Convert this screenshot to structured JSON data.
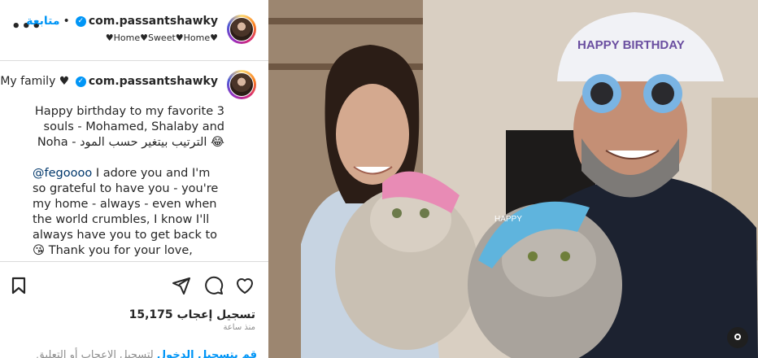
{
  "header": {
    "username": "com.passantshawky",
    "follow_label": "متابعة",
    "more_label": "•••",
    "subtitle": "♥Home♥Sweet♥Home♥"
  },
  "caption": {
    "title_prefix": "My family ♥",
    "username": "com.passantshawky",
    "paragraph1": "Happy birthday to my favorite 3 souls - Mohamed, Shalaby and Noha - الترتيب بيتغير حسب المود 😂",
    "paragraph2_mention": "@fegoooo",
    "paragraph2_text": " I adore you and I'm so grateful to have you - you're my home - always - even when the world crumbles, I know I'll always have you to get back to 😘 Thank you for your love, generosity and"
  },
  "actions": {
    "likes": "15,175 تسجيل إعجاب",
    "time": "منذ ساعة",
    "login_link": "قم بتسجيل الدخول",
    "login_rest": " لتسجيل الإعجاب أو التعليق"
  },
  "photo": {
    "hat_text": "HAPPY BIRTHDAY",
    "cat_hat_text": "HAPPY"
  },
  "icons": [
    "more-icon",
    "verified-icon",
    "bookmark-icon",
    "share-icon",
    "comment-icon",
    "heart-icon",
    "user-tag-icon"
  ],
  "colors": {
    "follow": "#0095f6",
    "verified": "#0095f6",
    "text": "#262626",
    "muted": "#8e8e8e"
  }
}
